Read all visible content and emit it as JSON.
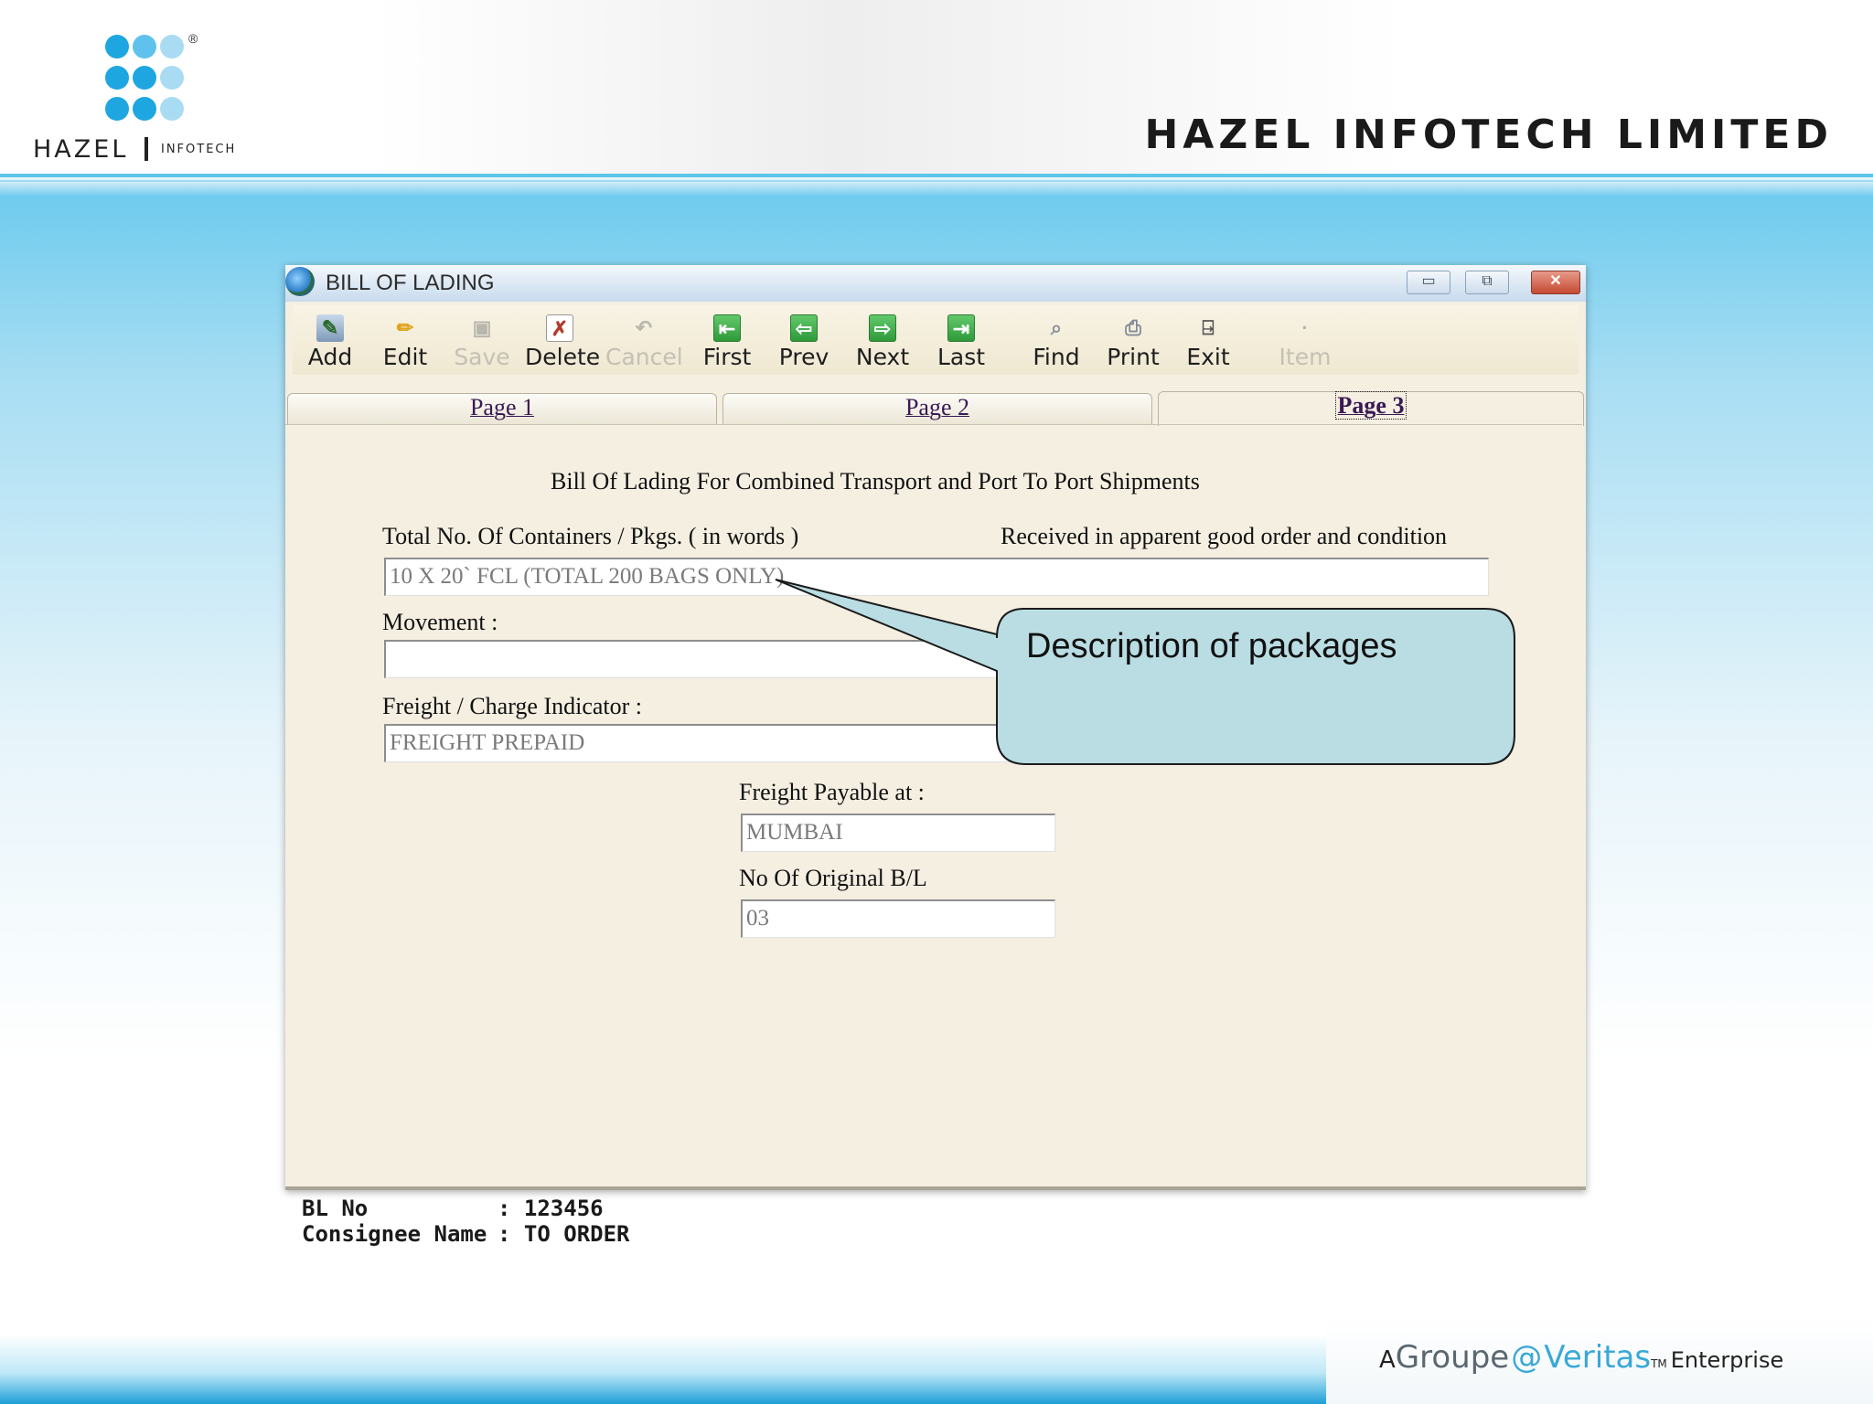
{
  "header": {
    "logo_text": "HAZEL",
    "logo_subtext": "INFOTECH",
    "logo_reg": "®",
    "company_name": "HAZEL INFOTECH LIMITED"
  },
  "window": {
    "title": "BILL OF LADING",
    "minimize": "▭",
    "restore": "⧉",
    "close": "✕"
  },
  "toolbar": {
    "add": "Add",
    "edit": "Edit",
    "save": "Save",
    "delete": "Delete",
    "cancel": "Cancel",
    "first": "First",
    "prev": "Prev",
    "next": "Next",
    "last": "Last",
    "find": "Find",
    "print": "Print",
    "exit": "Exit",
    "item": "Item"
  },
  "tabs": {
    "page1": "Page 1",
    "page2": "Page 2",
    "page3": "Page 3",
    "active": "page3"
  },
  "form": {
    "title": "Bill Of Lading For Combined Transport and Port To Port Shipments",
    "containers_label": "Total No. Of Containers / Pkgs. ( in words )",
    "received_label": "Received in apparent good order and condition",
    "containers_value": "10 X 20` FCL (TOTAL 200 BAGS ONLY)",
    "movement_label": "Movement :",
    "movement_value": "",
    "freight_label": "Freight / Charge Indicator :",
    "freight_value": "FREIGHT PREPAID",
    "payable_label": "Freight Payable at :",
    "payable_value": "MUMBAI",
    "original_label": "No Of Original B/L",
    "original_value": "03"
  },
  "status": {
    "bl_no_label": "BL No",
    "bl_no_value": "123456",
    "consignee_label": "Consignee Name",
    "consignee_value": "TO ORDER"
  },
  "callout": {
    "text": "Description of packages"
  },
  "footer": {
    "prefix": "A",
    "groupe": "Groupe",
    "veritas": "Veritas",
    "tm": "TM",
    "enterprise": "Enterprise"
  },
  "colors": {
    "accent": "#5cc5ea",
    "window_bg": "#f4efe1",
    "callout_fill": "#b9dde3",
    "toolbar_green": "#2e9a3a"
  },
  "icons": {
    "window": "globe-icon",
    "add": "add-icon",
    "edit": "pencil-icon",
    "save": "save-icon",
    "delete": "delete-icon",
    "cancel": "undo-icon",
    "first": "arrow-first-icon",
    "prev": "arrow-left-icon",
    "next": "arrow-right-icon",
    "last": "arrow-last-icon",
    "find": "find-icon",
    "print": "printer-icon",
    "exit": "door-exit-icon",
    "item": "item-icon"
  }
}
